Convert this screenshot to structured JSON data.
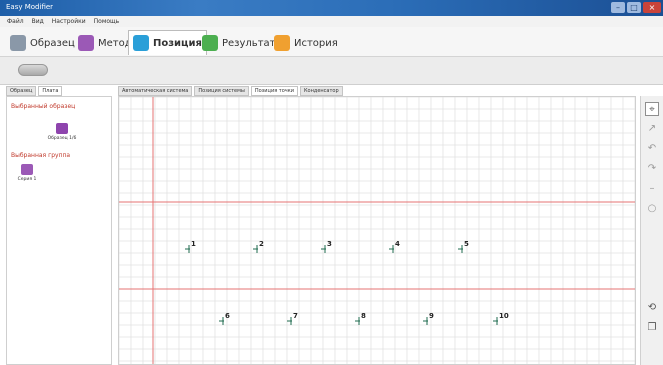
{
  "window": {
    "title": "Easy Modifier"
  },
  "menu": [
    "Файл",
    "Вид",
    "Настройки",
    "Помощь"
  ],
  "mode_tabs": [
    {
      "label": "Образец",
      "icon": "sample-icon",
      "color": "#7a8a99"
    },
    {
      "label": "Метод",
      "icon": "method-icon",
      "color": "#9b59b6"
    },
    {
      "label": "Позиция",
      "icon": "position-icon",
      "color": "#2a9fd8"
    },
    {
      "label": "Результат",
      "icon": "result-icon",
      "color": "#4caf50"
    },
    {
      "label": "История",
      "icon": "history-icon",
      "color": "#f0a030"
    }
  ],
  "active_mode": "Позиция",
  "side_tabs": [
    "Образец",
    "Плата"
  ],
  "sidebar": {
    "heading1": "Выбранный образец",
    "item1_caption": "Образец 1/6",
    "heading2": "Выбранная группа",
    "item2_caption": "Серия 1"
  },
  "view_tabs": [
    "Автоматическая система",
    "Позиция системы",
    "Позиция точки",
    "Конденсатор"
  ],
  "active_view_tab": "Позиция точки",
  "positions": [
    "1",
    "2",
    "3",
    "4",
    "5",
    "6",
    "7",
    "8",
    "9",
    "10"
  ],
  "right_tools": [
    "select-icon",
    "draw-icon",
    "undo-icon",
    "redo-icon",
    "minus-icon",
    "circle-icon",
    "move-icon",
    "copy-icon"
  ],
  "colors": {
    "accent": "#2a9fd8",
    "grid_red": "#e57373",
    "marker": "#1f6b4f"
  }
}
